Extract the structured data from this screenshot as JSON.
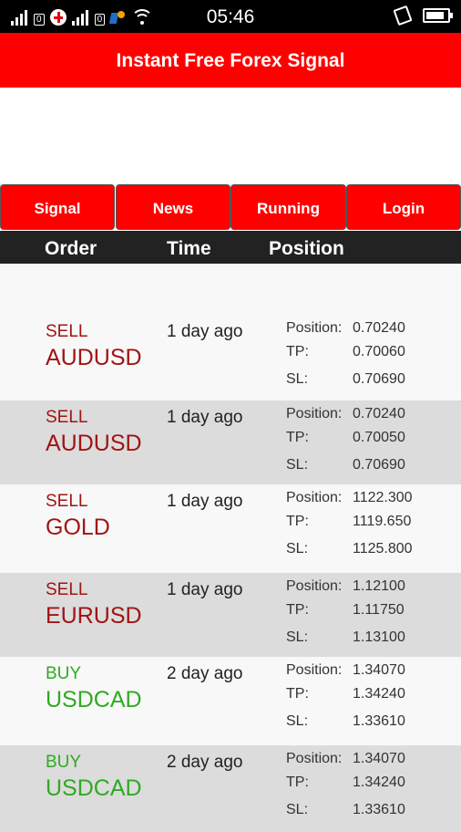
{
  "status_bar": {
    "time": "05:46",
    "sim1_slot": "0",
    "sim2_slot": "0",
    "icons": [
      "signal-icon",
      "carrier-icon",
      "signal-icon",
      "network-badge-icon",
      "wifi-icon",
      "vibrate-icon",
      "battery-icon"
    ],
    "battery_level": 0.85
  },
  "app": {
    "title": "Instant Free Forex Signal",
    "accent_color": "#ff0000",
    "sell_color": "#a11414",
    "buy_color": "#2faa22"
  },
  "nav": {
    "tabs": [
      {
        "label": "Signal"
      },
      {
        "label": "News"
      },
      {
        "label": "Running"
      },
      {
        "label": "Login"
      }
    ]
  },
  "columns": {
    "order": "Order",
    "time": "Time",
    "position": "Position"
  },
  "signals": [
    {
      "direction": "SELL",
      "symbol": "AUDUSD",
      "time": "1 day ago",
      "position_label": "Position:",
      "position": "0.70240",
      "tp_label": "TP:",
      "tp": "0.70060",
      "sl_label": "SL:",
      "sl": "0.70690"
    },
    {
      "direction": "SELL",
      "symbol": "AUDUSD",
      "time": "1 day ago",
      "position_label": "Position:",
      "position": "0.70240",
      "tp_label": "TP:",
      "tp": "0.70050",
      "sl_label": "SL:",
      "sl": "0.70690"
    },
    {
      "direction": "SELL",
      "symbol": "GOLD",
      "time": "1 day ago",
      "position_label": "Position:",
      "position": "1122.300",
      "tp_label": "TP:",
      "tp": "1119.650",
      "sl_label": "SL:",
      "sl": "1125.800"
    },
    {
      "direction": "SELL",
      "symbol": "EURUSD",
      "time": "1 day ago",
      "position_label": "Position:",
      "position": "1.12100",
      "tp_label": "TP:",
      "tp": "1.11750",
      "sl_label": "SL:",
      "sl": "1.13100"
    },
    {
      "direction": "BUY",
      "symbol": "USDCAD",
      "time": "2 day ago",
      "position_label": "Position:",
      "position": "1.34070",
      "tp_label": "TP:",
      "tp": "1.34240",
      "sl_label": "SL:",
      "sl": "1.33610"
    },
    {
      "direction": "BUY",
      "symbol": "USDCAD",
      "time": "2 day ago",
      "position_label": "Position:",
      "position": "1.34070",
      "tp_label": "TP:",
      "tp": "1.34240",
      "sl_label": "SL:",
      "sl": "1.33610"
    }
  ]
}
